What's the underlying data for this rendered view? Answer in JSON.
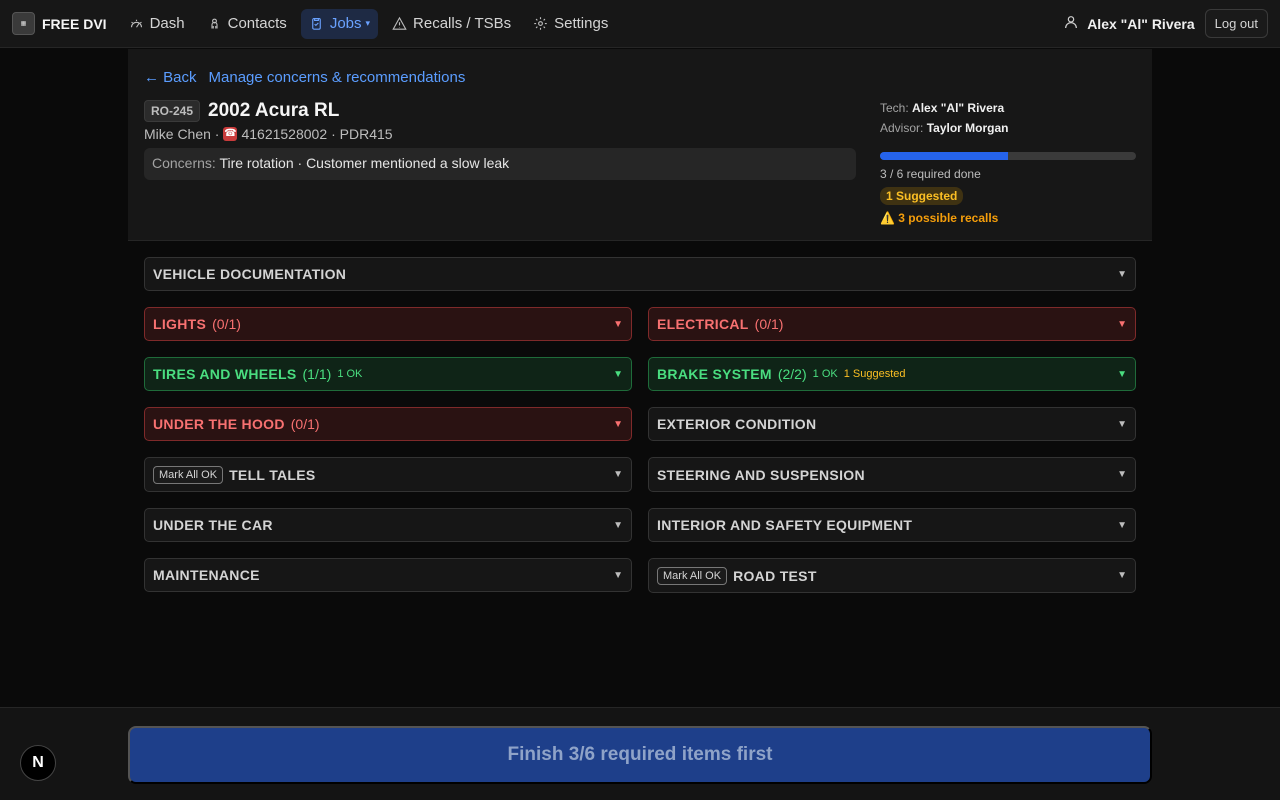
{
  "nav": {
    "logo_text": "FREE DVI",
    "brand": "FREE DVI",
    "items": [
      {
        "label": "Dash",
        "icon": "gauge-icon"
      },
      {
        "label": "Contacts",
        "icon": "contacts-icon"
      },
      {
        "label": "Jobs",
        "icon": "clipboard-icon"
      },
      {
        "label": "Recalls / TSBs",
        "icon": "warning-icon"
      },
      {
        "label": "Settings",
        "icon": "gear-icon"
      }
    ],
    "jobs_caret": "▾",
    "user": "Alex \"Al\" Rivera",
    "logout": "Log out"
  },
  "header": {
    "back": "← Back",
    "manage": "Manage concerns & recommendations",
    "ro": "RO-245",
    "vehicle": "2002 Acura RL",
    "customer": "Mike Chen ·",
    "phone": "41621528002",
    "plate": "· PDR415",
    "concerns_label": "Concerns:",
    "concerns_text": "Tire rotation · Customer mentioned a slow leak",
    "tech_label": "Tech:",
    "tech": "Alex \"Al\" Rivera",
    "advisor_label": "Advisor:",
    "advisor": "Taylor Morgan",
    "progress_fraction": 0.5,
    "required_done": "3 / 6 required done",
    "suggested_badge": "1 Suggested",
    "recalls": "⚠️ 3 possible recalls"
  },
  "categories": {
    "vehicle_doc": {
      "name": "VEHICLE DOCUMENTATION"
    },
    "lights": {
      "name": "LIGHTS",
      "count": "(0/1)"
    },
    "electrical": {
      "name": "ELECTRICAL",
      "count": "(0/1)"
    },
    "tires": {
      "name": "TIRES AND WHEELS",
      "count": "(1/1)",
      "ok": "1 OK"
    },
    "brakes": {
      "name": "BRAKE SYSTEM",
      "count": "(2/2)",
      "ok": "1 OK",
      "suggested": "1 Suggested"
    },
    "hood": {
      "name": "UNDER THE HOOD",
      "count": "(0/1)"
    },
    "exterior": {
      "name": "EXTERIOR CONDITION"
    },
    "telltales": {
      "name": "TELL TALES",
      "markall": "Mark All OK"
    },
    "steering": {
      "name": "STEERING AND SUSPENSION"
    },
    "undercar": {
      "name": "UNDER THE CAR"
    },
    "interior": {
      "name": "INTERIOR AND SAFETY EQUIPMENT"
    },
    "maintenance": {
      "name": "MAINTENANCE"
    },
    "roadtest": {
      "name": "ROAD TEST",
      "markall": "Mark All OK"
    },
    "chevron": "▼"
  },
  "footer": {
    "finish": "Finish 3/6 required items first",
    "badge": "N"
  }
}
